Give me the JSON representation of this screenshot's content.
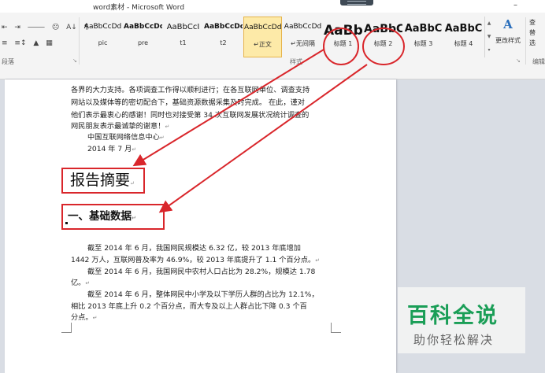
{
  "window": {
    "title": "word素材 - Microsoft Word",
    "minimize_glyph": "–"
  },
  "ribbon": {
    "paragraph_row1": [
      "⇤",
      "⇥",
      "⸻",
      "☹",
      "A↓",
      "¶"
    ],
    "paragraph_row2": [
      "≡",
      "≡↕",
      "▲",
      "▦"
    ],
    "paragraph_group_label": "段落",
    "styles_group_label": "样式",
    "editing_group_label": "编辑",
    "styles": [
      {
        "sample": "AaBbCcDd",
        "name": "pic",
        "selected": false,
        "size": "9px",
        "weight": "normal"
      },
      {
        "sample": "AaBbCcDc",
        "name": "pre",
        "selected": false,
        "size": "9px",
        "weight": "bold"
      },
      {
        "sample": "AaBbCcI",
        "name": "t1",
        "selected": false,
        "size": "10px",
        "weight": "normal"
      },
      {
        "sample": "AaBbCcDc",
        "name": "t2",
        "selected": false,
        "size": "9px",
        "weight": "bold"
      },
      {
        "sample": "AaBbCcDd",
        "name": "↵正文",
        "selected": true,
        "size": "9px",
        "weight": "normal"
      },
      {
        "sample": "AaBbCcDd",
        "name": "↵无间隔",
        "selected": false,
        "size": "9px",
        "weight": "normal"
      },
      {
        "sample": "AaBb",
        "name": "标题 1",
        "selected": false,
        "size": "17px",
        "weight": "bold"
      },
      {
        "sample": "AaBbC",
        "name": "标题 2",
        "selected": false,
        "size": "14px",
        "weight": "bold"
      },
      {
        "sample": "AaBbC",
        "name": "标题 3",
        "selected": false,
        "size": "13px",
        "weight": "bold"
      },
      {
        "sample": "AaBbC",
        "name": "标题 4",
        "selected": false,
        "size": "13px",
        "weight": "bold"
      }
    ],
    "change_styles": {
      "icon": "A",
      "label": "更改样式"
    },
    "editing": [
      "查",
      "替",
      "选"
    ]
  },
  "document": {
    "lines": [
      "各界的大力支持。各项调查工作得以顺利进行；在各互联网单位、调查支持",
      "网站以及媒体等的密切配合下，基础资源数据采集及时完成。 在此，谨对",
      "他们表示最衷心的感谢！同时也对接受第 34 次互联网发展状况统计调查的",
      "网民朋友表示最诚挚的谢意！",
      "中国互联网络信息中心",
      "2014 年 7 月",
      "截至 2014 年 6 月，我国网民规模达 6.32 亿，较 2013 年底增加",
      "1442 万人，互联网普及率为 46.9%，较 2013 年底提升了 1.1 个百分点。",
      "截至 2014 年 6 月，我国网民中农村人口占比为 28.2%，规模达 1.78",
      "亿。",
      "截至 2014 年 6 月，整体网民中小学及以下学历人群的占比为 12.1%，",
      "相比 2013 年底上升 0.2 个百分点，而大专及以上人群占比下降 0.3 个百",
      "分点。"
    ],
    "heading1": "报告摘要",
    "heading2": "一、基础数据"
  },
  "watermark": {
    "main": "百科全说",
    "sub": "助你轻松解决"
  },
  "colors": {
    "annotation_red": "#d9262b",
    "watermark_green": "#1a9e57",
    "selected_style_bg": "#fdeaa8"
  }
}
